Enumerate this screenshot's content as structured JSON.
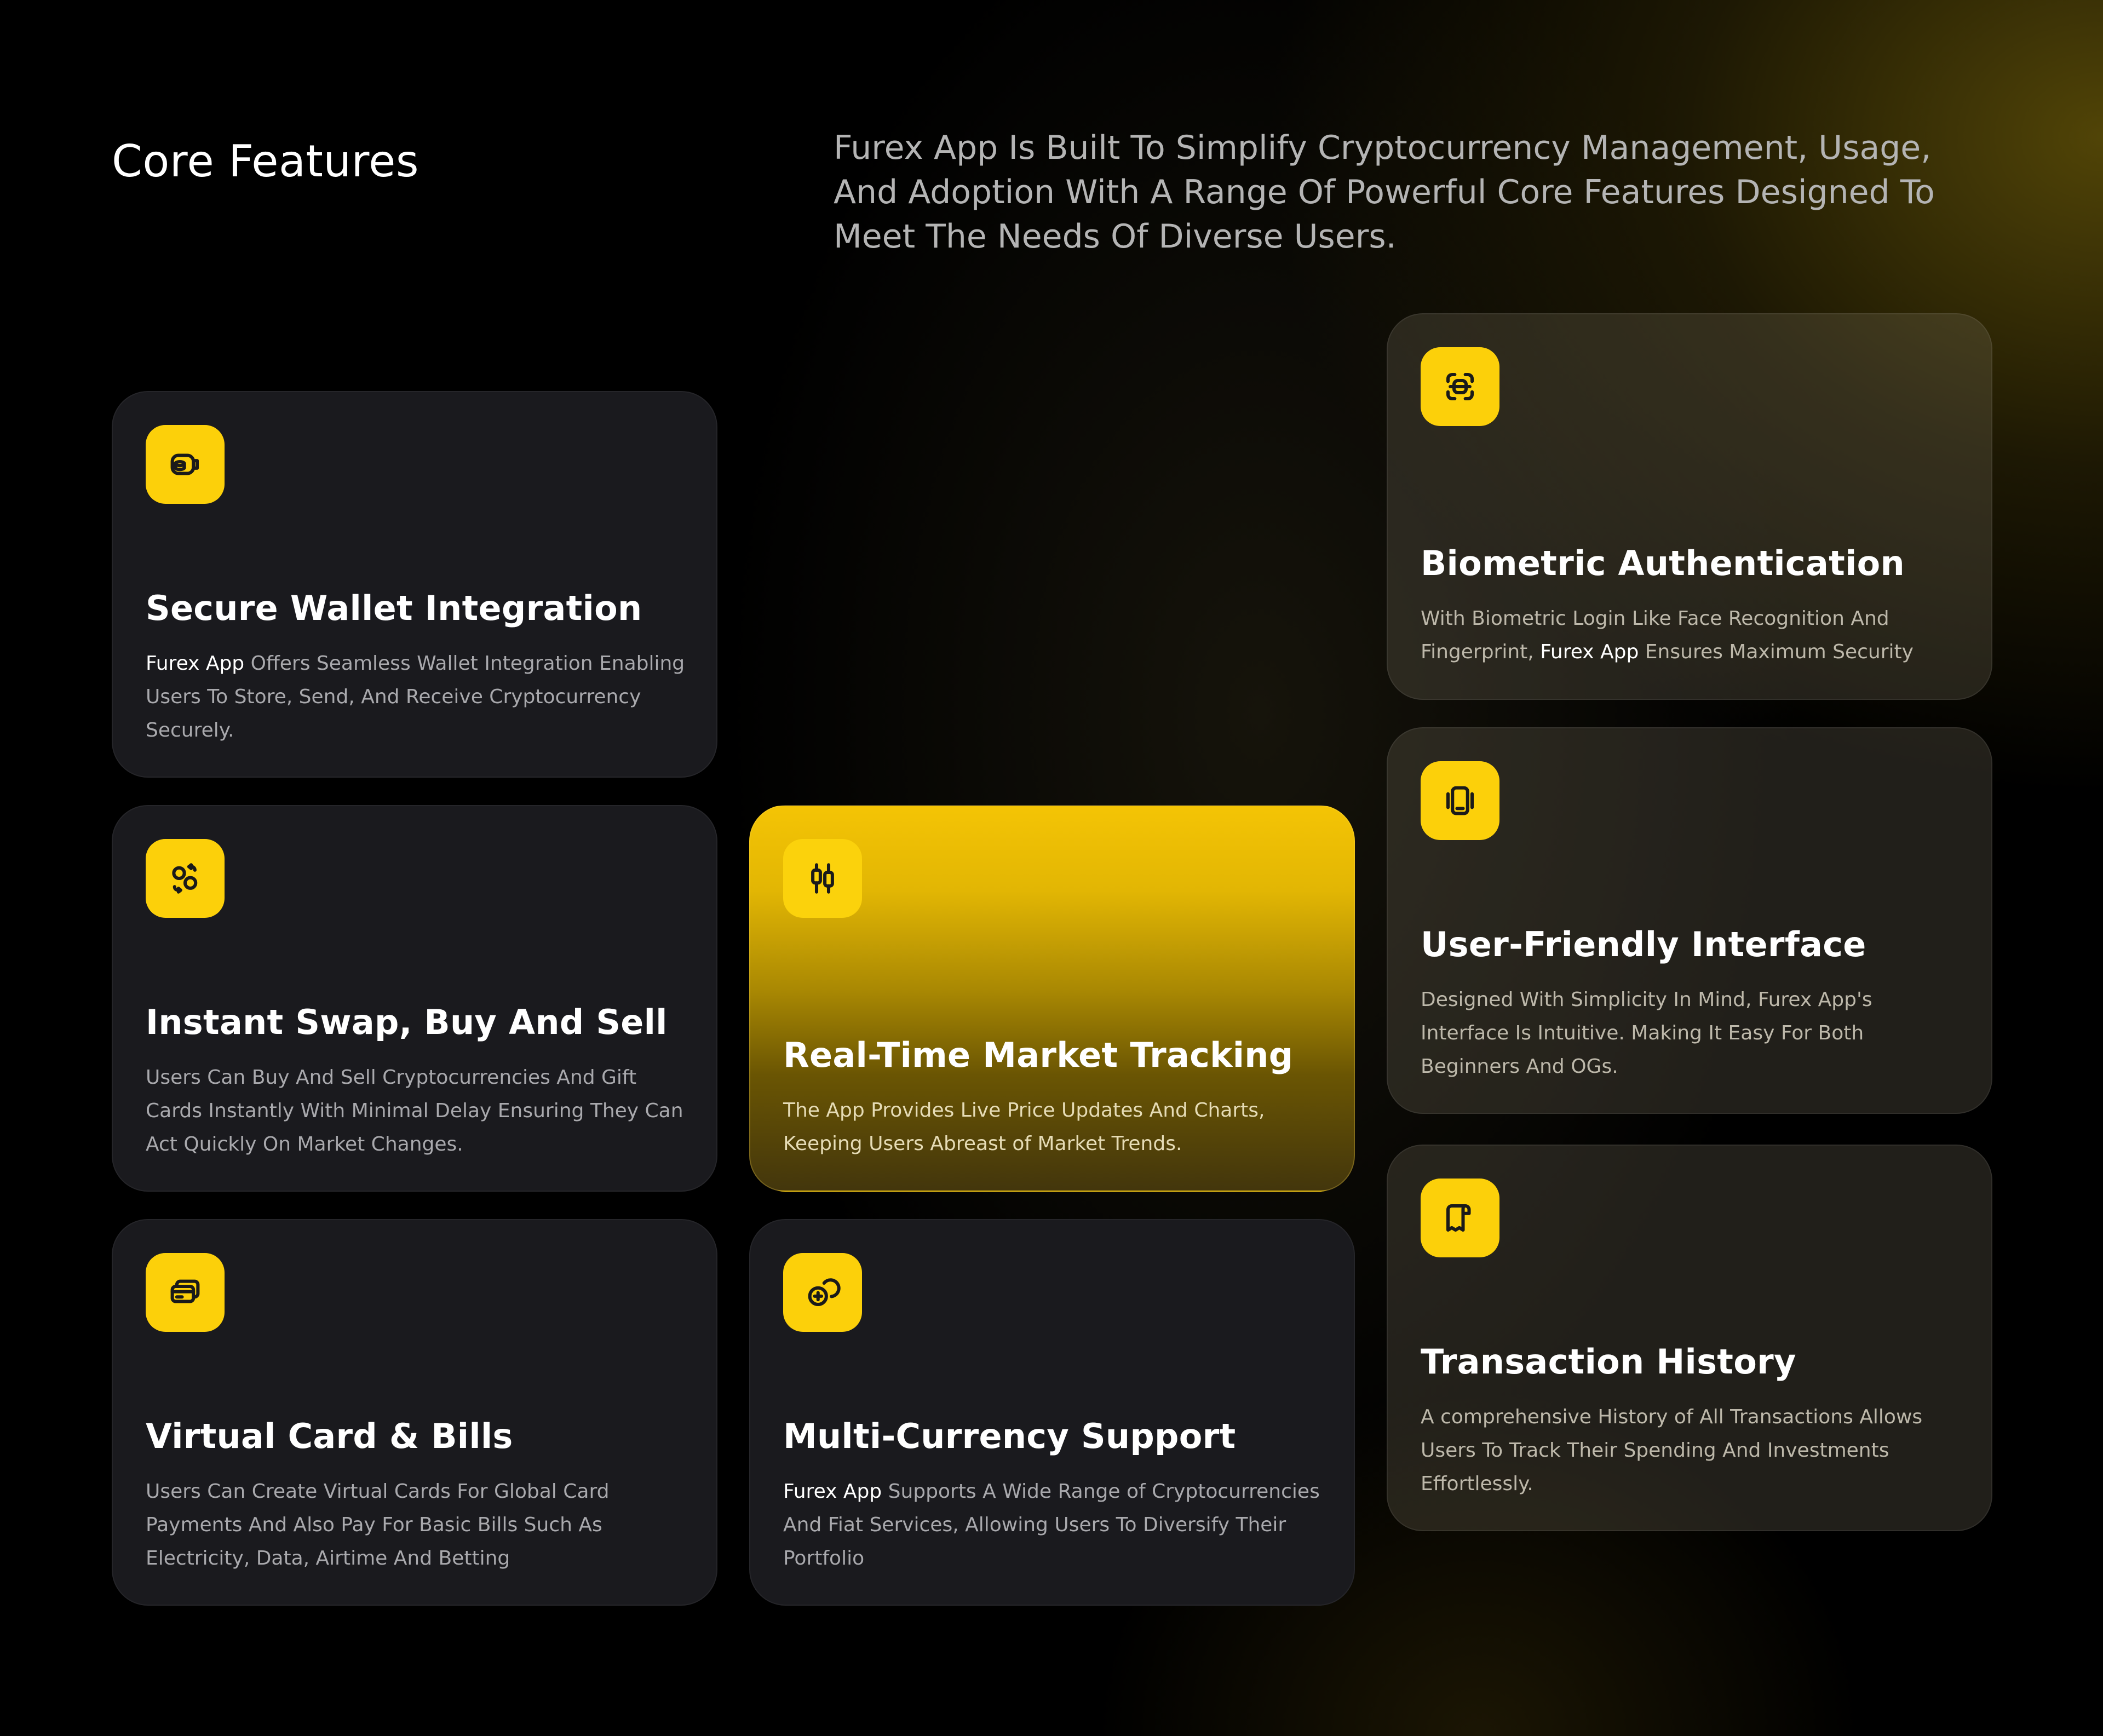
{
  "header": {
    "title": "Core Features",
    "intro": "Furex App Is Built To Simplify Cryptocurrency Management, Usage, And Adoption With A Range Of Powerful Core Features Designed To Meet The Needs Of Diverse Users."
  },
  "colors": {
    "accent": "#FCD00A",
    "card_dark": "#1A1A1E",
    "background": "#000000"
  },
  "cards": {
    "wallet": {
      "icon": "wallet-coins-icon",
      "title": "Secure Wallet Integration",
      "brand": "Furex App",
      "desc": " Offers Seamless Wallet Integration Enabling Users To Store, Send, And Receive Cryptocurrency Securely."
    },
    "swap": {
      "icon": "swap-exchange-icon",
      "title": "Instant Swap, Buy And Sell",
      "desc": "Users Can Buy And Sell Cryptocurrencies And Gift Cards Instantly With Minimal Delay Ensuring They Can Act Quickly On Market Changes."
    },
    "market": {
      "icon": "candlestick-chart-icon",
      "title": "Real-Time Market Tracking",
      "desc": "The App Provides Live Price Updates And Charts, Keeping Users Abreast of Market Trends."
    },
    "card_bills": {
      "icon": "card-stack-icon",
      "title": "Virtual Card & Bills",
      "desc": "Users Can Create Virtual Cards For Global Card Payments And Also Pay For Basic Bills Such As Electricity, Data, Airtime And Betting"
    },
    "multi": {
      "icon": "coins-icon",
      "title": "Multi-Currency Support",
      "brand": "Furex App",
      "desc": " Supports A Wide Range of Cryptocurrencies And Fiat Services, Allowing Users To Diversify Their Portfolio"
    },
    "biometric": {
      "icon": "face-scan-icon",
      "title": "Biometric Authentication",
      "desc_before": "With Biometric Login Like Face Recognition And Fingerprint, ",
      "brand": "Furex App",
      "desc_after": " Ensures Maximum Security"
    },
    "interface": {
      "icon": "mobile-interface-icon",
      "title": "User-Friendly Interface",
      "desc": "Designed With Simplicity In Mind, Furex App's Interface Is Intuitive. Making It Easy For Both Beginners And OGs."
    },
    "history": {
      "icon": "receipt-history-icon",
      "title": "Transaction History",
      "desc": "A comprehensive History of All Transactions Allows Users To Track Their Spending And Investments Effortlessly."
    }
  }
}
